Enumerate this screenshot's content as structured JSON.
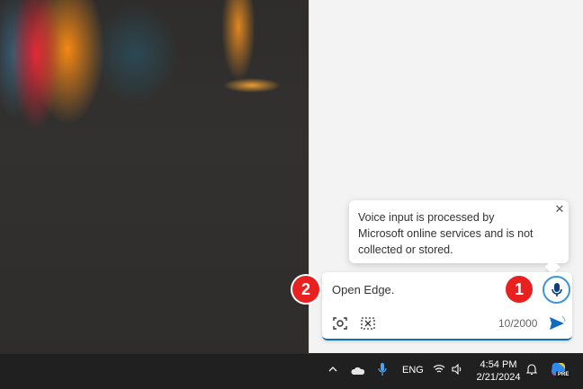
{
  "tooltip": {
    "text": "Voice input is processed by Microsoft online services and is not collected or stored.",
    "close_icon": "close-icon"
  },
  "composer": {
    "input_value": "Open Edge.",
    "char_count": "10/2000",
    "mic_icon": "microphone-icon",
    "screenshot_icon": "screenshot-icon",
    "snip_icon": "snip-icon",
    "send_icon": "send-icon"
  },
  "callouts": {
    "first": "1",
    "second": "2"
  },
  "taskbar": {
    "language": "ENG",
    "time": "4:54 PM",
    "date": "2/21/2024",
    "copilot_badge": "PRE"
  },
  "colors": {
    "accent": "#0f6cbd",
    "callout": "#e8201f",
    "taskbar": "#202020"
  }
}
